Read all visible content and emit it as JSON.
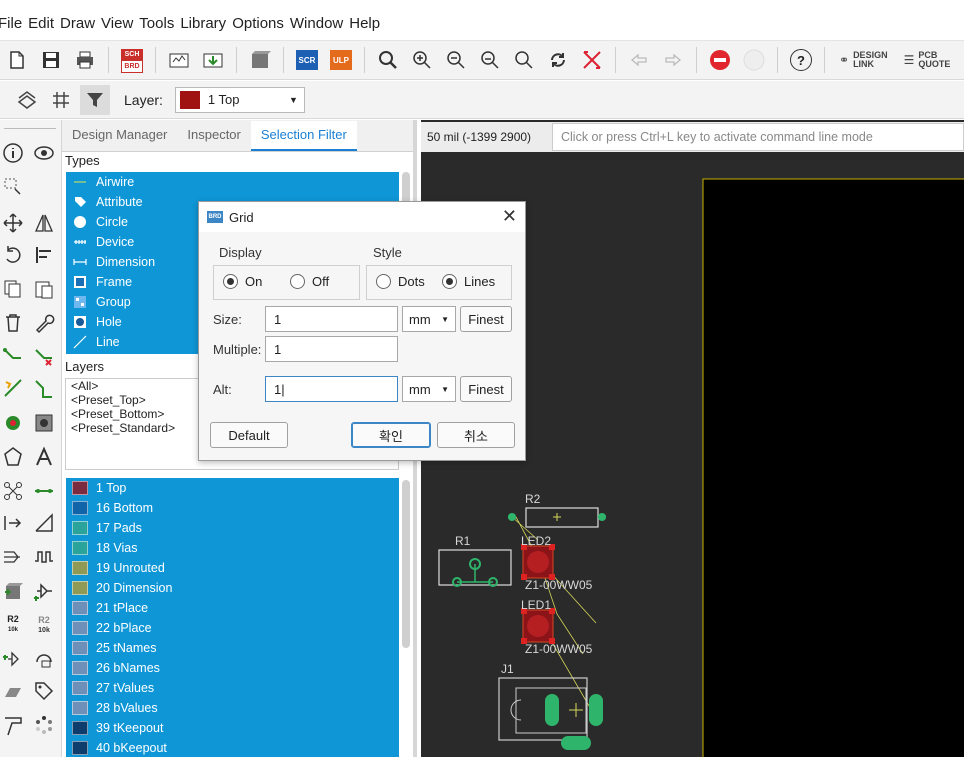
{
  "menu": [
    "File",
    "Edit",
    "Draw",
    "View",
    "Tools",
    "Library",
    "Options",
    "Window",
    "Help"
  ],
  "toolbar": {
    "sch_brd_top": "SCH",
    "sch_brd_bottom": "BRD",
    "scr": "SCR",
    "ulp": "ULP",
    "help": "?",
    "design_link_1": "DESIGN",
    "design_link_2": "LINK",
    "pcb_quote_1": "PCB",
    "pcb_quote_2": "QUOTE"
  },
  "layer_bar": {
    "label": "Layer:",
    "selected": "1 Top",
    "selected_color": "#a01111"
  },
  "panel": {
    "tabs": [
      "Design Manager",
      "Inspector",
      "Selection Filter"
    ],
    "active_tab": "Selection Filter",
    "types_title": "Types",
    "types": [
      "Airwire",
      "Attribute",
      "Circle",
      "Device",
      "Dimension",
      "Frame",
      "Group",
      "Hole",
      "Line"
    ],
    "layers_title": "Layers",
    "presets": [
      "<All>",
      "<Preset_Top>",
      "<Preset_Bottom>",
      "<Preset_Standard>"
    ],
    "layer_items": [
      {
        "name": "1 Top",
        "color": "#7a2b3f"
      },
      {
        "name": "16 Bottom",
        "color": "#1264a8"
      },
      {
        "name": "17 Pads",
        "color": "#2aa39b"
      },
      {
        "name": "18 Vias",
        "color": "#2aa39b"
      },
      {
        "name": "19 Unrouted",
        "color": "#8e9a55"
      },
      {
        "name": "20 Dimension",
        "color": "#8e9a55"
      },
      {
        "name": "21 tPlace",
        "color": "#6d8fb8"
      },
      {
        "name": "22 bPlace",
        "color": "#6d8fb8"
      },
      {
        "name": "25 tNames",
        "color": "#6d8fb8"
      },
      {
        "name": "26 bNames",
        "color": "#6d8fb8"
      },
      {
        "name": "27 tValues",
        "color": "#6d8fb8"
      },
      {
        "name": "28 bValues",
        "color": "#6d8fb8"
      },
      {
        "name": "39 tKeepout",
        "color": "#0e3d6b"
      },
      {
        "name": "40 bKeepout",
        "color": "#0e3d6b"
      }
    ]
  },
  "canvas": {
    "coord": "50 mil (-1399 2900)",
    "cmd_placeholder": "Click or press Ctrl+L key to activate command line mode",
    "labels": {
      "r2": "R2",
      "r1": "R1",
      "led2": "LED2",
      "led1": "LED1",
      "z1a": "Z1-00WW05",
      "z1b": "Z1-00WW05",
      "j1": "J1"
    }
  },
  "dialog": {
    "icon": "BRD",
    "title": "Grid",
    "display_label": "Display",
    "display_on": "On",
    "display_off": "Off",
    "style_label": "Style",
    "style_dots": "Dots",
    "style_lines": "Lines",
    "size_label": "Size:",
    "size_value": "1",
    "size_unit": "mm",
    "multiple_label": "Multiple:",
    "multiple_value": "1",
    "alt_label": "Alt:",
    "alt_value": "1|",
    "alt_unit": "mm",
    "finest": "Finest",
    "default_btn": "Default",
    "ok_btn": "확인",
    "cancel_btn": "취소"
  }
}
